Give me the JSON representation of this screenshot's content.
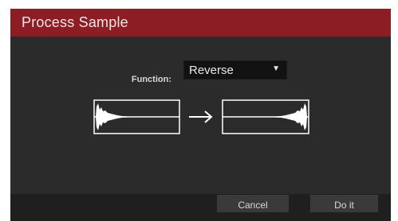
{
  "dialog": {
    "title": "Process Sample",
    "function_label": "Function:",
    "function_value": "Reverse",
    "caret_icon": "triangle-down",
    "cancel_label": "Cancel",
    "doit_label": "Do it"
  },
  "colors": {
    "title_bar": "#8c1d24",
    "panel": "#2b2b2b",
    "footer": "#1f1f1f",
    "button": "#3a3a3a",
    "select_bg": "#121212",
    "waveform": "#ffffff"
  },
  "icons": {
    "original_waveform": "waveform-icon",
    "arrow": "arrow-right-icon",
    "reversed_waveform": "reversed-waveform-icon"
  }
}
